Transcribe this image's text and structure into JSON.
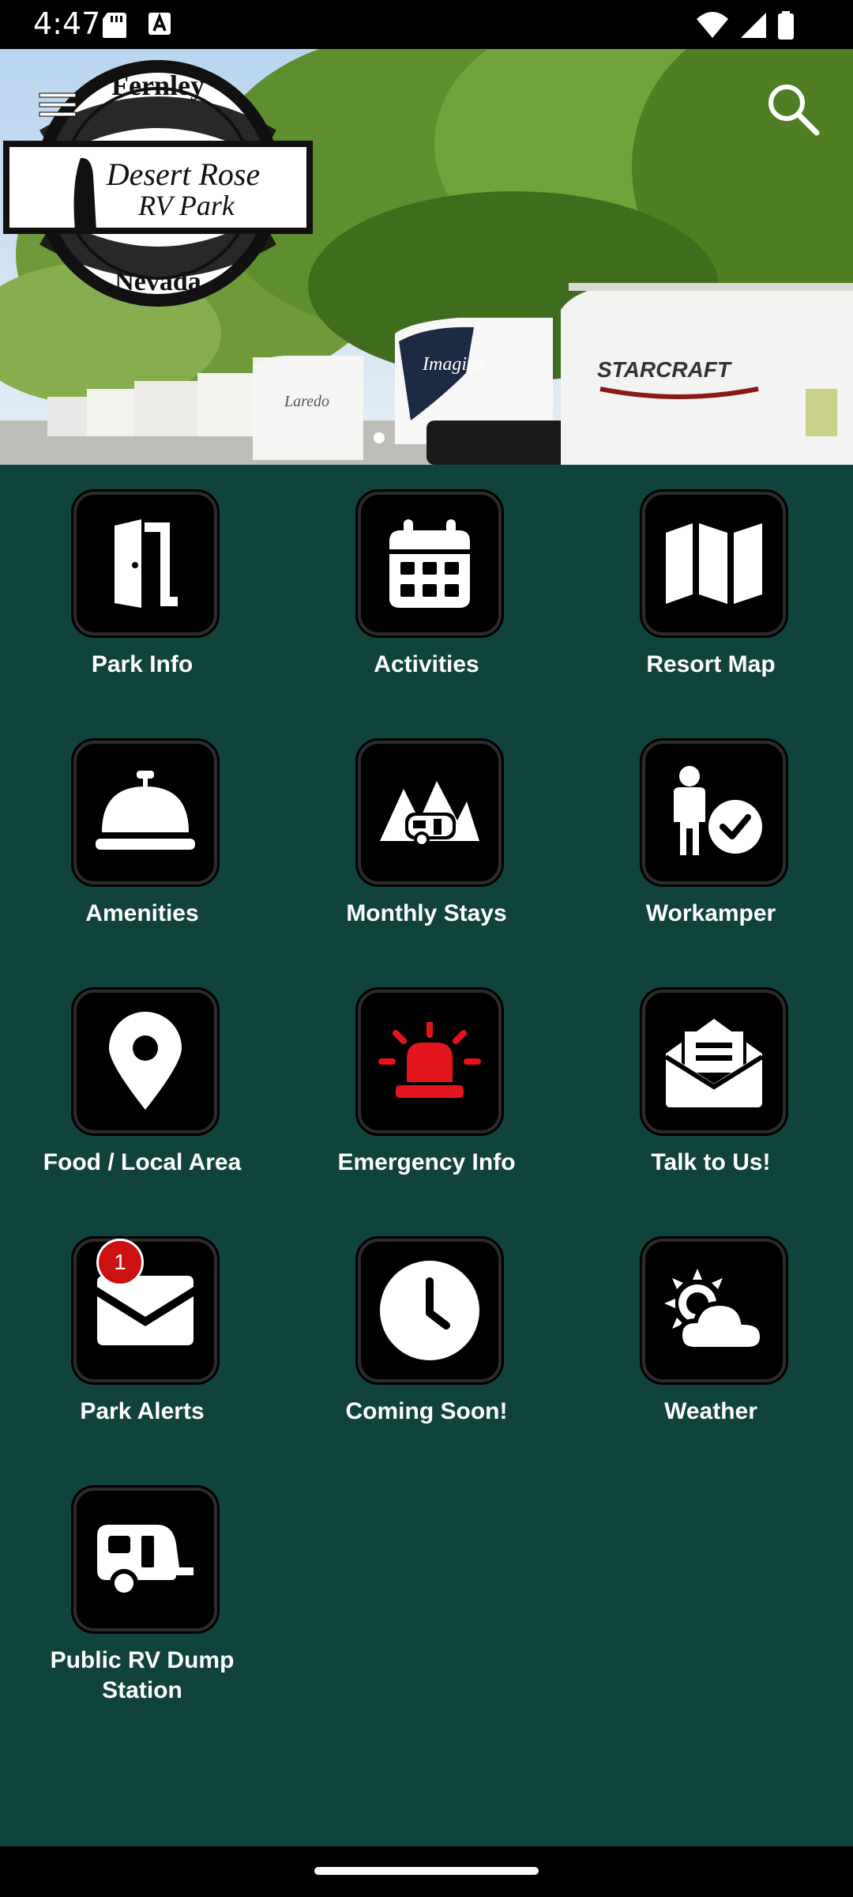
{
  "status_bar": {
    "time": "4:47"
  },
  "hero": {
    "logo_top": "Fernley",
    "logo_name_line1": "Desert Rose",
    "logo_name_line2": "RV Park",
    "logo_bottom": "Nevada",
    "rv_brand_1": "Laredo",
    "rv_brand_2": "Imagine",
    "rv_brand_3": "STARCRAFT"
  },
  "colors": {
    "background": "#0f433b",
    "tile": "#000000",
    "alert": "#e3141b",
    "badge": "#cc1111"
  },
  "tiles": [
    {
      "label": "Park Info",
      "icon": "door-icon"
    },
    {
      "label": "Activities",
      "icon": "calendar-icon"
    },
    {
      "label": "Resort Map",
      "icon": "map-icon"
    },
    {
      "label": "Amenities",
      "icon": "service-bell-icon"
    },
    {
      "label": "Monthly Stays",
      "icon": "camper-trees-icon"
    },
    {
      "label": "Workamper",
      "icon": "person-check-icon"
    },
    {
      "label": "Food / Local Area",
      "icon": "location-pin-icon"
    },
    {
      "label": "Emergency Info",
      "icon": "siren-icon"
    },
    {
      "label": "Talk to Us!",
      "icon": "open-envelope-icon"
    },
    {
      "label": "Park Alerts",
      "icon": "envelope-icon",
      "badge": "1"
    },
    {
      "label": "Coming Soon!",
      "icon": "clock-icon"
    },
    {
      "label": "Weather",
      "icon": "sun-cloud-icon"
    },
    {
      "label": "Public RV Dump Station",
      "icon": "trailer-icon"
    }
  ]
}
